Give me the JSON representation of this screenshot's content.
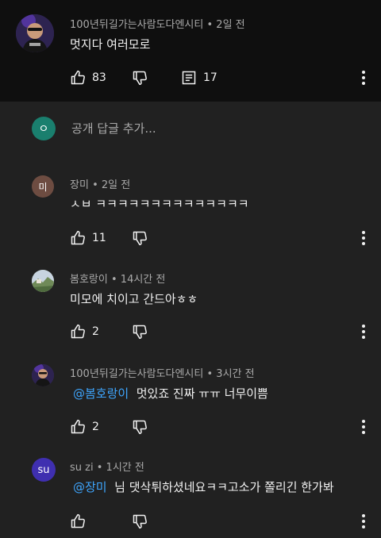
{
  "parent_comment": {
    "author": "100년뒤길가는사람도다엔시티",
    "time": "2일 전",
    "text": "멋지다 여러모로",
    "likes": "83",
    "replies": "17"
  },
  "reply_box": {
    "avatar_letter": "ㅇ",
    "placeholder": "공개 답글 추가..."
  },
  "replies": [
    {
      "author": "장미",
      "time": "2일 전",
      "avatar_text": "미",
      "avatar_color": "#6d4c41",
      "mention": "",
      "text": "ㅅㅂ ㅋㅋㅋㅋㅋㅋㅋㅋㅋㅋㅋㅋㅋㅋ",
      "likes": "11"
    },
    {
      "author": "봄호랑이",
      "time": "14시간 전",
      "avatar_text": "",
      "avatar_color": "#7b8f6a",
      "mention": "",
      "text": "미모에 치이고 간드아ㅎㅎ",
      "likes": "2"
    },
    {
      "author": "100년뒤길가는사람도다엔시티",
      "time": "3시간 전",
      "avatar_text": "",
      "avatar_color": "#3b2a6b",
      "mention": "@봄호랑이",
      "text": "멋있죠 진짜 ㅠㅠ 너무이쁨",
      "likes": "2"
    },
    {
      "author": "su zi",
      "time": "1시간 전",
      "avatar_text": "su",
      "avatar_color": "#3f2fb0",
      "mention": "@장미",
      "text": "님 댓삭튀하셨네요ㅋㅋ고소가 쫄리긴 한가봐",
      "likes": ""
    }
  ],
  "separator": "•",
  "colors": {
    "background": "#212121",
    "parent_background": "#0f0f0f",
    "text": "#f1f1f1",
    "secondary_text": "#aaaaaa",
    "mention": "#3ea6ff",
    "reply_avatar": "#1a7f6e"
  }
}
